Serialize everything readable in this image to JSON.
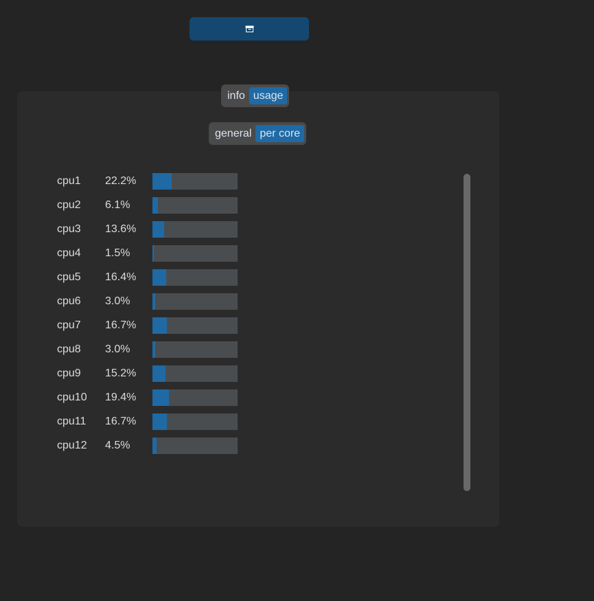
{
  "top_button": {
    "icon": "archive-icon"
  },
  "main_tabs": [
    {
      "label": "info",
      "active": false
    },
    {
      "label": "usage",
      "active": true
    }
  ],
  "sub_tabs": [
    {
      "label": "general",
      "active": false
    },
    {
      "label": "per core",
      "active": true
    }
  ],
  "cores": [
    {
      "name": "cpu1",
      "percent": "22.2%",
      "value": 22.2
    },
    {
      "name": "cpu2",
      "percent": "6.1%",
      "value": 6.1
    },
    {
      "name": "cpu3",
      "percent": "13.6%",
      "value": 13.6
    },
    {
      "name": "cpu4",
      "percent": "1.5%",
      "value": 1.5
    },
    {
      "name": "cpu5",
      "percent": "16.4%",
      "value": 16.4
    },
    {
      "name": "cpu6",
      "percent": "3.0%",
      "value": 3.0
    },
    {
      "name": "cpu7",
      "percent": "16.7%",
      "value": 16.7
    },
    {
      "name": "cpu8",
      "percent": "3.0%",
      "value": 3.0
    },
    {
      "name": "cpu9",
      "percent": "15.2%",
      "value": 15.2
    },
    {
      "name": "cpu10",
      "percent": "19.4%",
      "value": 19.4
    },
    {
      "name": "cpu11",
      "percent": "16.7%",
      "value": 16.7
    },
    {
      "name": "cpu12",
      "percent": "4.5%",
      "value": 4.5
    }
  ],
  "colors": {
    "accent": "#1f6aa5",
    "button": "#144870",
    "panel": "#2b2b2b",
    "background": "#242424",
    "bar_track": "#4a4d50"
  }
}
